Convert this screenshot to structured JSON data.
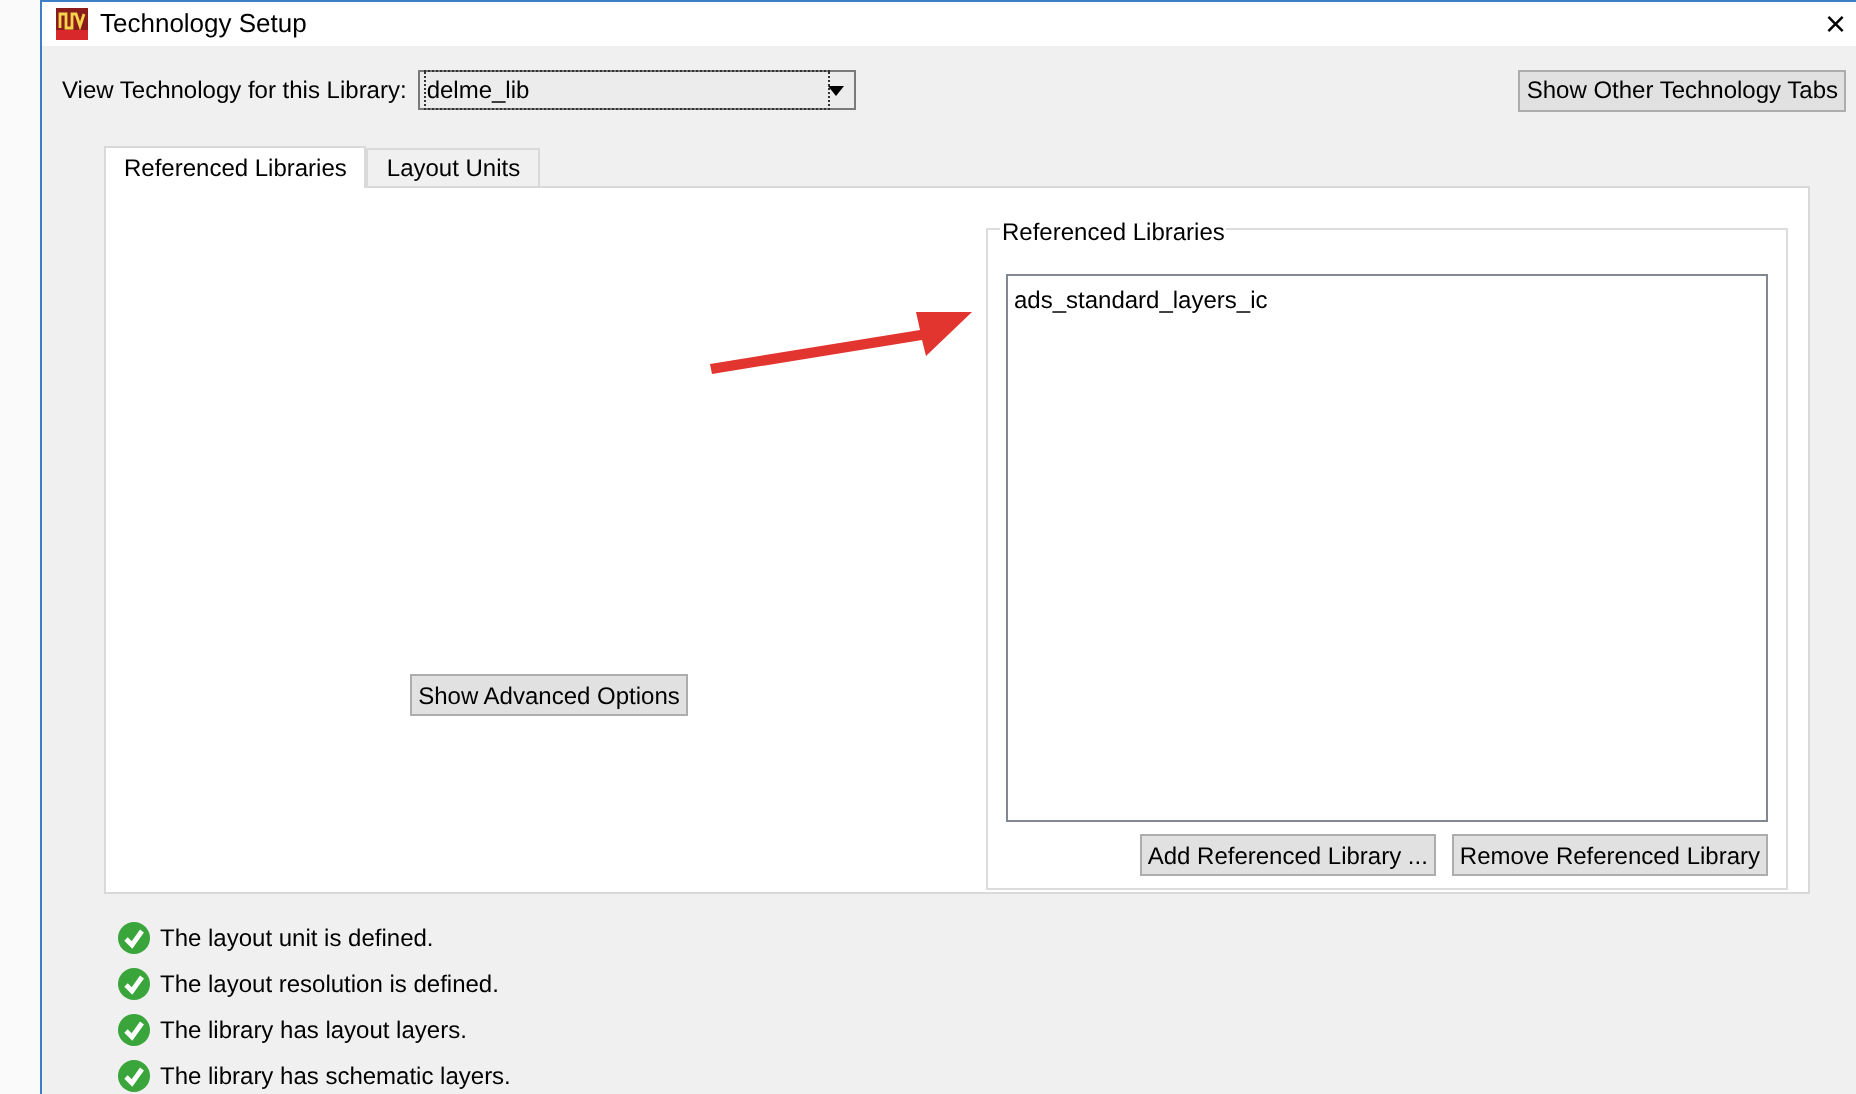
{
  "window": {
    "title": "Technology Setup",
    "close": "×"
  },
  "library_selector": {
    "label": "View Technology for this Library:",
    "value": "delme_lib"
  },
  "show_other_tabs_button": "Show Other Technology Tabs",
  "tabs": [
    {
      "label": "Referenced Libraries",
      "selected": true
    },
    {
      "label": "Layout Units",
      "selected": false
    }
  ],
  "advanced_options_button": "Show Advanced Options",
  "referenced_libraries": {
    "title": "Referenced Libraries",
    "items": [
      "ads_standard_layers_ic"
    ],
    "buttons": [
      "Add Referenced Library ...",
      "Remove Referenced Library"
    ]
  },
  "status": [
    {
      "text": "The layout unit is defined.",
      "ok": true
    },
    {
      "text": "The layout resolution is defined.",
      "ok": true
    },
    {
      "text": "The library has layout layers.",
      "ok": true
    },
    {
      "text": "The library has schematic layers.",
      "ok": true
    }
  ]
}
